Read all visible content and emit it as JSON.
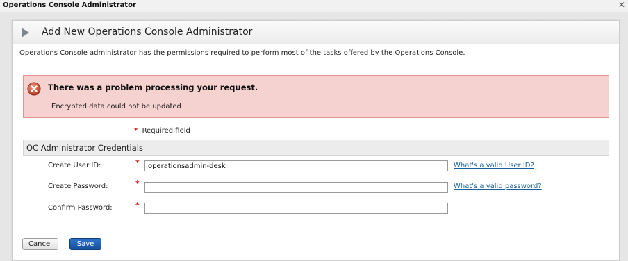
{
  "window": {
    "title": "Operations Console Administrator",
    "close_icon": "close-icon"
  },
  "dialog": {
    "header_icon": "play-arrow-icon",
    "title": "Add New Operations Console Administrator",
    "description": "Operations Console administrator has the permissions required to perform most of the tasks offered by the Operations Console."
  },
  "error": {
    "icon": "error-x-icon",
    "title": "There was a problem processing your request.",
    "message": "Encrypted data could not be updated",
    "colors": {
      "background": "#f5d1d0",
      "border": "#e39490",
      "icon": "#c94a2f"
    }
  },
  "required_note": {
    "star": "*",
    "text": "Required field"
  },
  "section": {
    "title": "OC Administrator Credentials"
  },
  "form": {
    "user_id": {
      "label": "Create User ID:",
      "star": "*",
      "value": "operationsadmin-desk",
      "help": "What's a valid User ID?"
    },
    "password": {
      "label": "Create Password:",
      "star": "*",
      "value": "",
      "help": "What's a valid password?"
    },
    "confirm_password": {
      "label": "Confirm Password:",
      "star": "*",
      "value": ""
    }
  },
  "buttons": {
    "cancel": "Cancel",
    "save": "Save"
  },
  "colors": {
    "required_star": "#d01616",
    "link": "#1a5f9c",
    "primary_button": "#1f5fb0"
  }
}
